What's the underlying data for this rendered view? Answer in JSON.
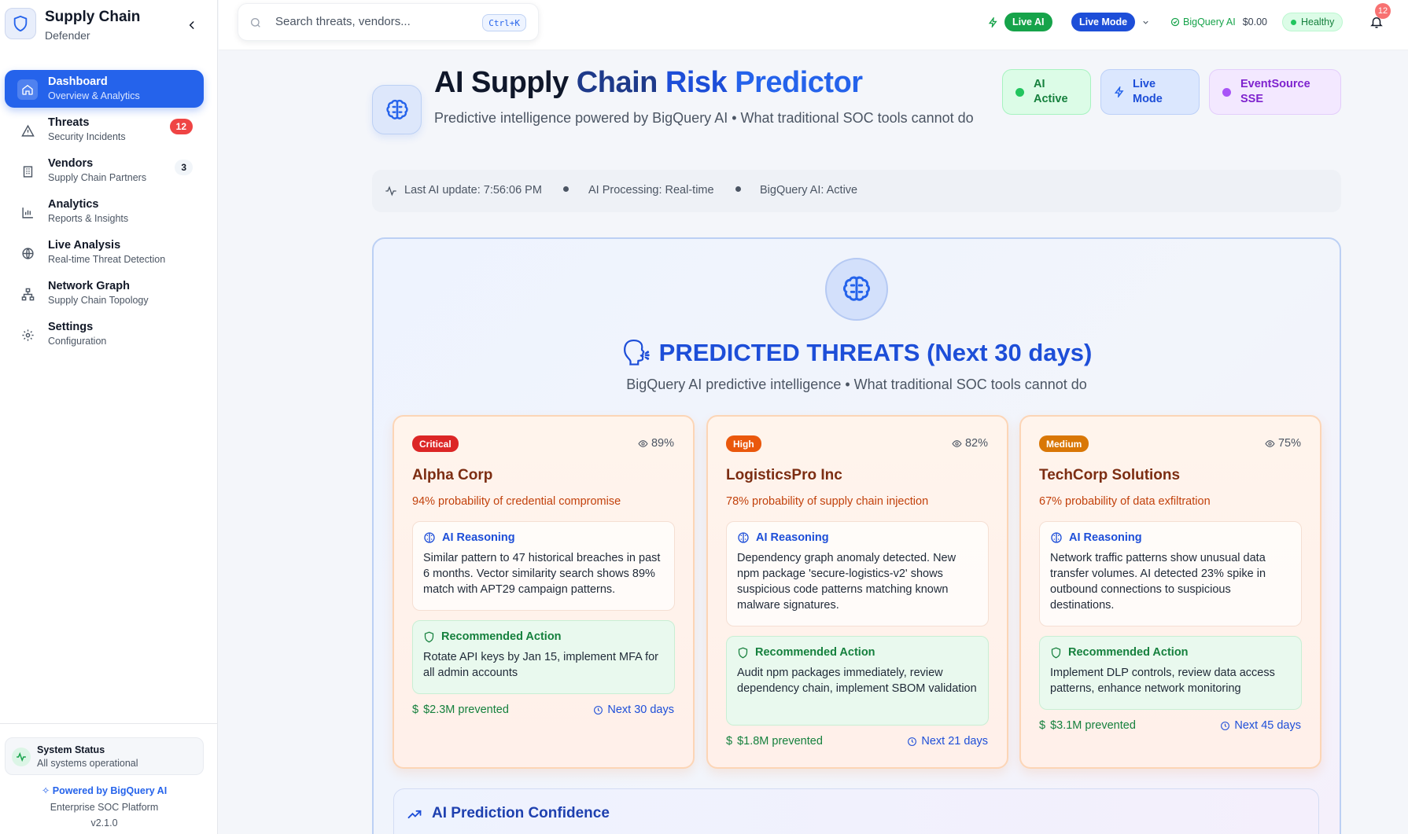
{
  "brand": {
    "title": "Supply Chain",
    "subtitle": "Defender"
  },
  "nav": [
    {
      "label": "Dashboard",
      "sub": "Overview & Analytics",
      "icon": "home-icon"
    },
    {
      "label": "Threats",
      "sub": "Security Incidents",
      "icon": "alert-triangle-icon",
      "badge": "12"
    },
    {
      "label": "Vendors",
      "sub": "Supply Chain Partners",
      "icon": "building-icon",
      "badge": "3"
    },
    {
      "label": "Analytics",
      "sub": "Reports & Insights",
      "icon": "bar-chart-icon"
    },
    {
      "label": "Live Analysis",
      "sub": "Real-time Threat Detection",
      "icon": "globe-icon"
    },
    {
      "label": "Network Graph",
      "sub": "Supply Chain Topology",
      "icon": "network-icon"
    },
    {
      "label": "Settings",
      "sub": "Configuration",
      "icon": "gear-icon"
    }
  ],
  "system_status": {
    "title": "System Status",
    "sub": "All systems operational"
  },
  "footer": {
    "powered": "Powered by BigQuery AI",
    "platform": "Enterprise SOC Platform",
    "version": "v2.1.0"
  },
  "topbar": {
    "search_placeholder": "Search threats, vendors...",
    "shortcut": "Ctrl+K",
    "live_ai": "Live AI",
    "live_mode": "Live Mode",
    "bigquery_label": "BigQuery AI",
    "cost": "$0.00",
    "health": "Healthy",
    "notifications": "12"
  },
  "hero": {
    "title_parts": [
      "AI Supply",
      "Chain",
      "Risk",
      "Predictor"
    ],
    "subtitle": "Predictive intelligence powered by BigQuery AI • What traditional SOC tools cannot do",
    "badges": [
      "AI Active",
      "Live Mode",
      "EventSource SSE"
    ]
  },
  "status_bar": {
    "last_update": "Last AI update: 7:56:06 PM",
    "processing": "AI Processing: Real-time",
    "bigquery": "BigQuery AI: Active"
  },
  "predictions": {
    "title": "PREDICTED THREATS (Next 30 days)",
    "emoji": "🗣",
    "subtitle": "BigQuery AI predictive intelligence • What traditional SOC tools cannot do",
    "reasoning_label": "AI Reasoning",
    "action_label": "Recommended Action",
    "cards": [
      {
        "severity": "Critical",
        "confidence": "89%",
        "vendor": "Alpha Corp",
        "probability": "94% probability of credential compromise",
        "reasoning": "Similar pattern to 47 historical breaches in past 6 months. Vector similarity search shows 89% match with APT29 campaign patterns.",
        "action": "Rotate API keys by Jan 15, implement MFA for all admin accounts",
        "prevented": "$2.3M prevented",
        "window": "Next 30 days"
      },
      {
        "severity": "High",
        "confidence": "82%",
        "vendor": "LogisticsPro Inc",
        "probability": "78% probability of supply chain injection",
        "reasoning": "Dependency graph anomaly detected. New npm package 'secure-logistics-v2' shows suspicious code patterns matching known malware signatures.",
        "action": "Audit npm packages immediately, review dependency chain, implement SBOM validation",
        "prevented": "$1.8M prevented",
        "window": "Next 21 days"
      },
      {
        "severity": "Medium",
        "confidence": "75%",
        "vendor": "TechCorp Solutions",
        "probability": "67% probability of data exfiltration",
        "reasoning": "Network traffic patterns show unusual data transfer volumes. AI detected 23% spike in outbound connections to suspicious destinations.",
        "action": "Implement DLP controls, review data access patterns, enhance network monitoring",
        "prevented": "$3.1M prevented",
        "window": "Next 45 days"
      }
    ]
  },
  "confidence_section": {
    "title": "AI Prediction Confidence"
  },
  "colors": {
    "primary": "#2563eb",
    "critical": "#dc2626",
    "high": "#ea580c",
    "medium": "#d97706",
    "success": "#16a34a"
  }
}
